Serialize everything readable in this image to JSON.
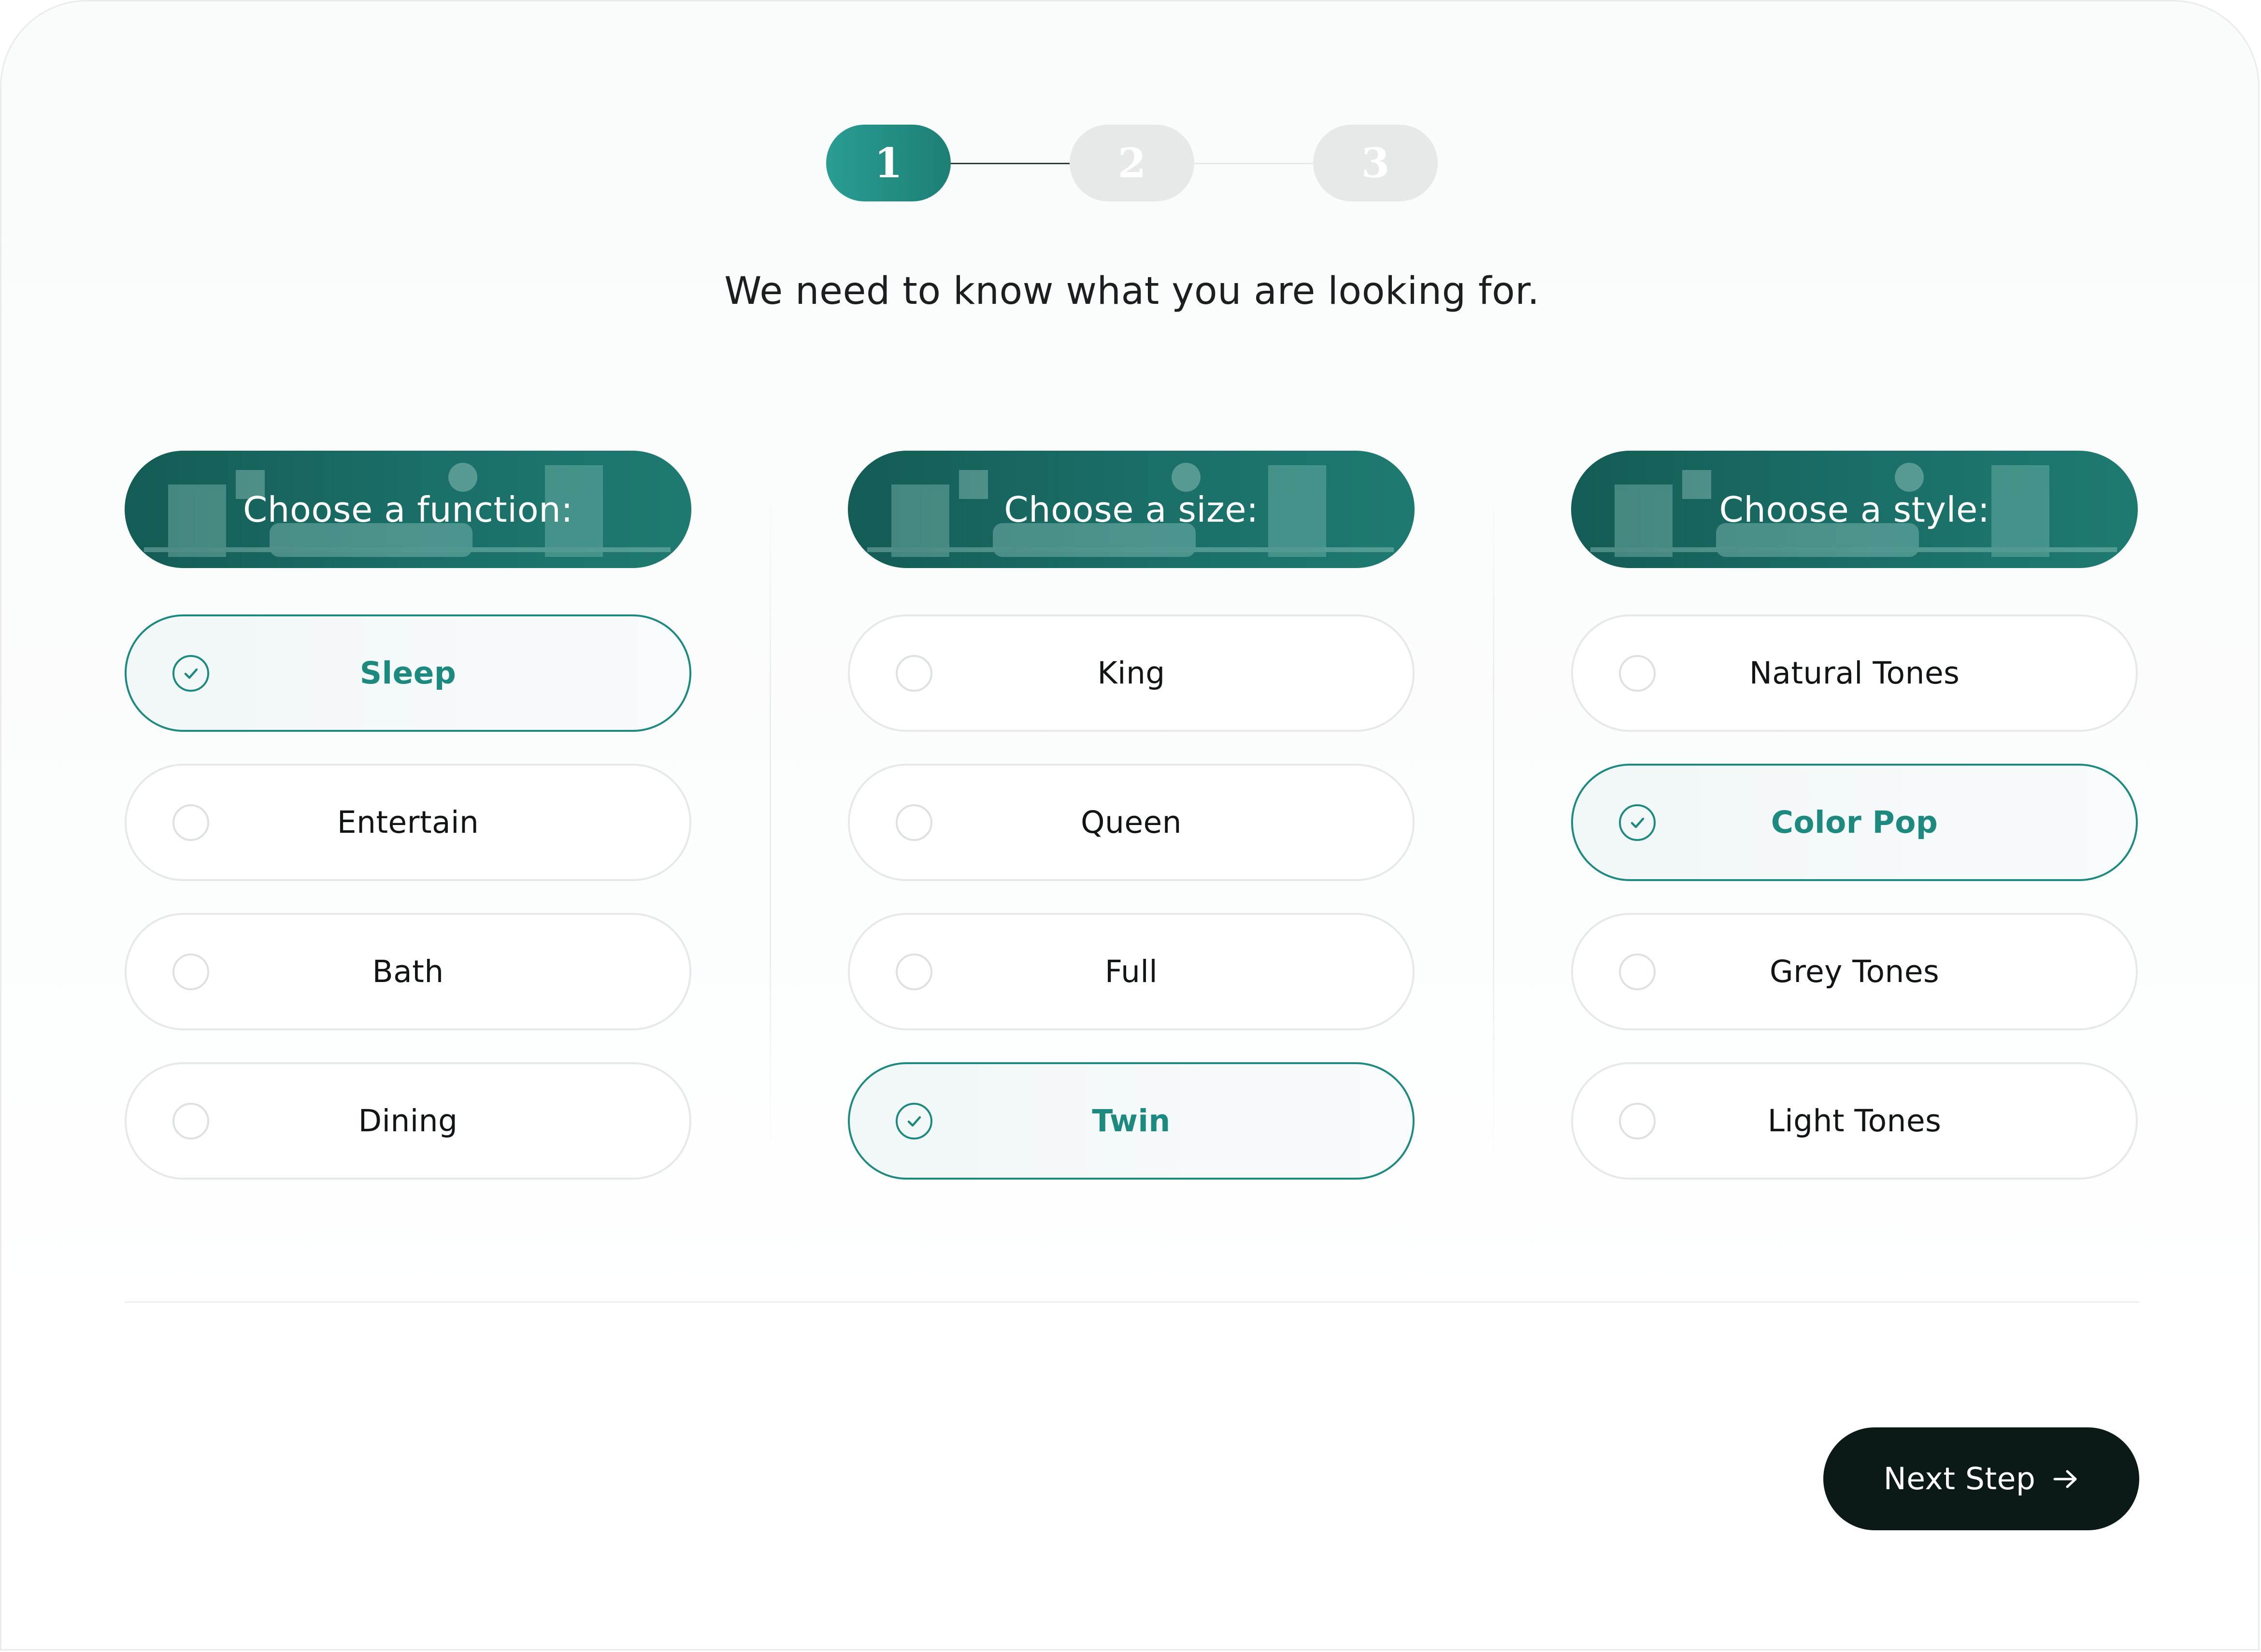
{
  "stepper": {
    "steps": [
      {
        "label": "1",
        "state": "active"
      },
      {
        "label": "2",
        "state": "inactive"
      },
      {
        "label": "3",
        "state": "inactive"
      }
    ]
  },
  "subtitle": "We need to know what you are looking for.",
  "columns": [
    {
      "header": "Choose a function:",
      "options": [
        {
          "label": "Sleep",
          "selected": true
        },
        {
          "label": "Entertain",
          "selected": false
        },
        {
          "label": "Bath",
          "selected": false
        },
        {
          "label": "Dining",
          "selected": false
        }
      ]
    },
    {
      "header": "Choose a size:",
      "options": [
        {
          "label": "King",
          "selected": false
        },
        {
          "label": "Queen",
          "selected": false
        },
        {
          "label": "Full",
          "selected": false
        },
        {
          "label": "Twin",
          "selected": true
        }
      ]
    },
    {
      "header": "Choose a style:",
      "options": [
        {
          "label": "Natural Tones",
          "selected": false
        },
        {
          "label": "Color Pop",
          "selected": true
        },
        {
          "label": "Grey Tones",
          "selected": false
        },
        {
          "label": "Light Tones",
          "selected": false
        }
      ]
    }
  ],
  "next_button": {
    "label": "Next Step",
    "icon": "arrow-right-icon"
  },
  "colors": {
    "accent": "#1e8a7f",
    "header_bg": "#1a6e67",
    "button_bg": "#0b1a18",
    "inactive_step": "#e7e9e9"
  }
}
